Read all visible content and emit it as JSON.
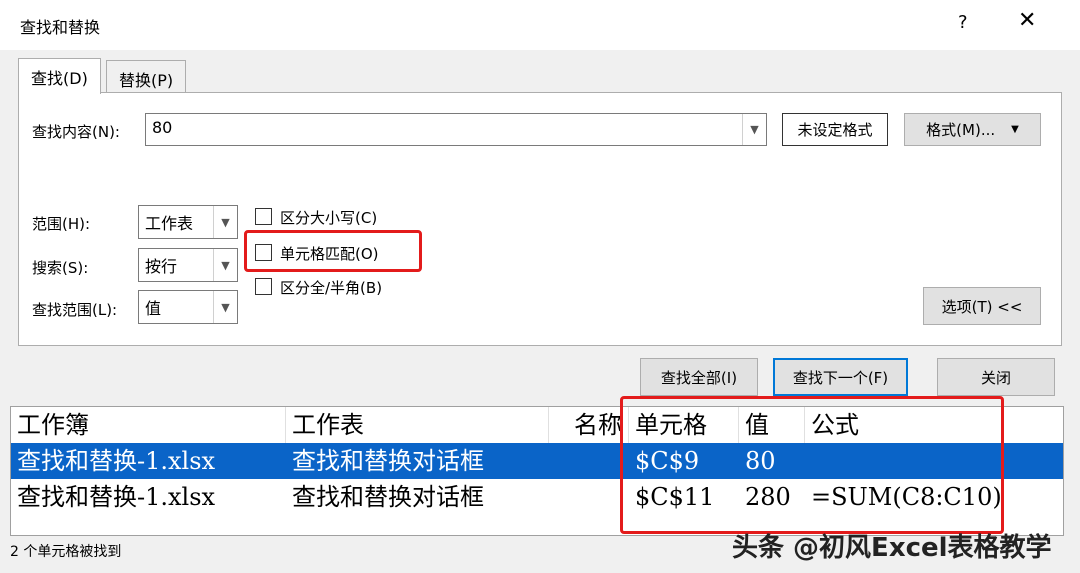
{
  "dialog": {
    "title": "查找和替换",
    "help_label": "?",
    "close_label": "✕"
  },
  "tabs": [
    {
      "label": "查找(D)",
      "active": true
    },
    {
      "label": "替换(P)",
      "active": false
    }
  ],
  "find": {
    "label": "查找内容(N):",
    "value": "80",
    "format_preview": "未设定格式",
    "format_button": "格式(M)..."
  },
  "options": {
    "scope_label": "范围(H):",
    "scope_value": "工作表",
    "search_label": "搜索(S):",
    "search_value": "按行",
    "lookin_label": "查找范围(L):",
    "lookin_value": "值",
    "match_case": {
      "label": "区分大小写(C)",
      "checked": false
    },
    "match_cell": {
      "label": "单元格匹配(O)",
      "checked": false
    },
    "match_width": {
      "label": "区分全/半角(B)",
      "checked": false
    },
    "options_button": "选项(T) <<"
  },
  "buttons": {
    "find_all": "查找全部(I)",
    "find_next": "查找下一个(F)",
    "close": "关闭"
  },
  "results": {
    "columns": [
      "工作簿",
      "工作表",
      "名称",
      "单元格",
      "值",
      "公式"
    ],
    "rows": [
      [
        "查找和替换-1.xlsx",
        "查找和替换对话框",
        "",
        "$C$9",
        "80",
        ""
      ],
      [
        "查找和替换-1.xlsx",
        "查找和替换对话框",
        "",
        "$C$11",
        "280",
        "=SUM(C8:C10)"
      ]
    ],
    "selected_row": 0
  },
  "status": "2 个单元格被找到",
  "watermark": "头条 @初风Excel表格教学",
  "colors": {
    "selection": "#0a64c8",
    "highlight": "#e31b1b",
    "focus": "#0078d7"
  }
}
